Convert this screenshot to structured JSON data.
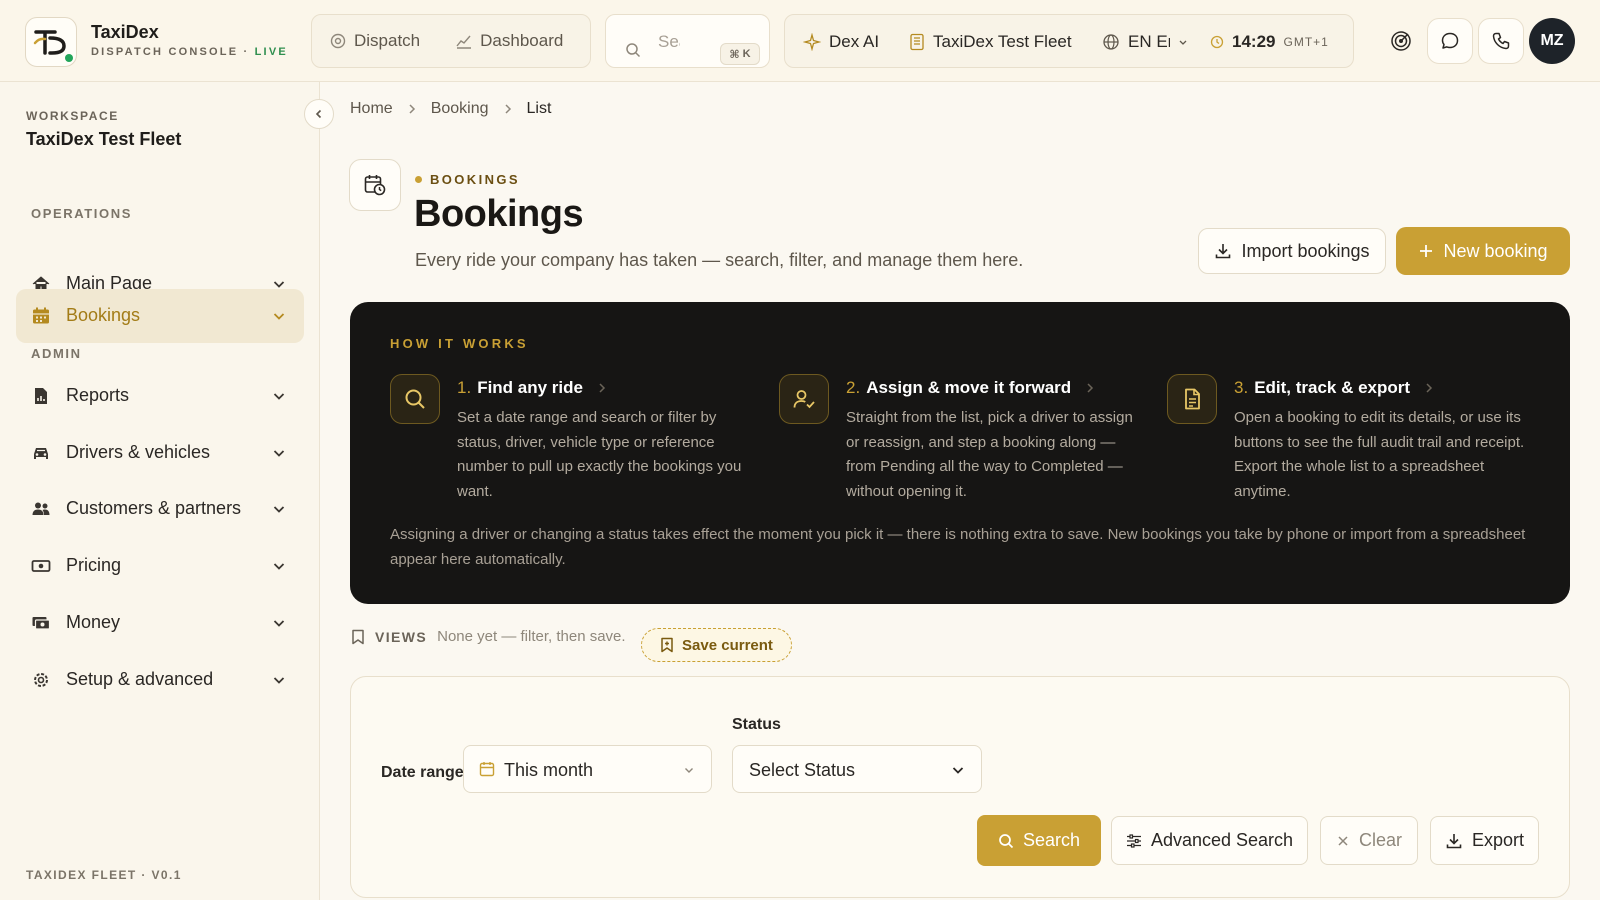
{
  "header": {
    "brand_name": "TaxiDex",
    "brand_sub": "DISPATCH CONSOLE ·",
    "brand_live": "LIVE",
    "nav": [
      {
        "label": "Dispatch",
        "icon": "dispatch-icon"
      },
      {
        "label": "Dashboard",
        "icon": "dashboard-icon"
      }
    ],
    "search_placeholder": "Search",
    "search_shortcut_key": "K",
    "dex_ai_label": "Dex AI",
    "fleet_label": "TaxiDex Test Fleet",
    "language_label": "EN English",
    "time": "14:29",
    "timezone": "GMT+1",
    "avatar_initials": "MZ"
  },
  "sidebar": {
    "workspace_label": "WORKSPACE",
    "workspace_name": "TaxiDex Test Fleet",
    "operations_label": "OPERATIONS",
    "admin_label": "ADMIN",
    "items": [
      {
        "label": "Main Page",
        "icon": "home-icon"
      },
      {
        "label": "Bookings",
        "icon": "calendar-icon",
        "active": true
      },
      {
        "label": "Reports",
        "icon": "report-icon"
      },
      {
        "label": "Drivers & vehicles",
        "icon": "car-icon"
      },
      {
        "label": "Customers & partners",
        "icon": "users-icon"
      },
      {
        "label": "Pricing",
        "icon": "money-icon"
      },
      {
        "label": "Money",
        "icon": "wallet-icon"
      },
      {
        "label": "Setup & advanced",
        "icon": "settings-icon"
      }
    ],
    "footer": "TAXIDEX FLEET · V0.1"
  },
  "breadcrumb": [
    "Home",
    "Booking",
    "List"
  ],
  "page": {
    "eyebrow": "BOOKINGS",
    "title": "Bookings",
    "subtitle": "Every ride your company has taken — search, filter, and manage them here.",
    "import_label": "Import bookings",
    "new_label": "New booking"
  },
  "how_it_works": {
    "title": "HOW IT WORKS",
    "steps": [
      {
        "num": "1.",
        "title": "Find any ride",
        "body": "Set a date range and search or filter by status, driver, vehicle type or reference number to pull up exactly the bookings you want."
      },
      {
        "num": "2.",
        "title": "Assign & move it forward",
        "body": "Straight from the list, pick a driver to assign or reassign, and step a booking along — from Pending all the way to Completed — without opening it."
      },
      {
        "num": "3.",
        "title": "Edit, track & export",
        "body": "Open a booking to edit its details, or use its buttons to see the full audit trail and receipt. Export the whole list to a spreadsheet anytime."
      }
    ],
    "footer": "Assigning a driver or changing a status takes effect the moment you pick it — there is nothing extra to save. New bookings you take by phone or import from a spreadsheet appear here automatically."
  },
  "views": {
    "label": "VIEWS",
    "empty_text": "None yet — filter, then save.",
    "save_label": "Save current"
  },
  "filters": {
    "date_label": "Date range",
    "date_value": "This month",
    "status_label": "Status",
    "status_value": "Select Status",
    "search_label": "Search",
    "advanced_label": "Advanced Search",
    "clear_label": "Clear",
    "export_label": "Export"
  },
  "colors": {
    "accent": "#c9a034",
    "dark_panel": "#161514",
    "live_green": "#2f8f4f",
    "background": "#fbf8f1"
  }
}
